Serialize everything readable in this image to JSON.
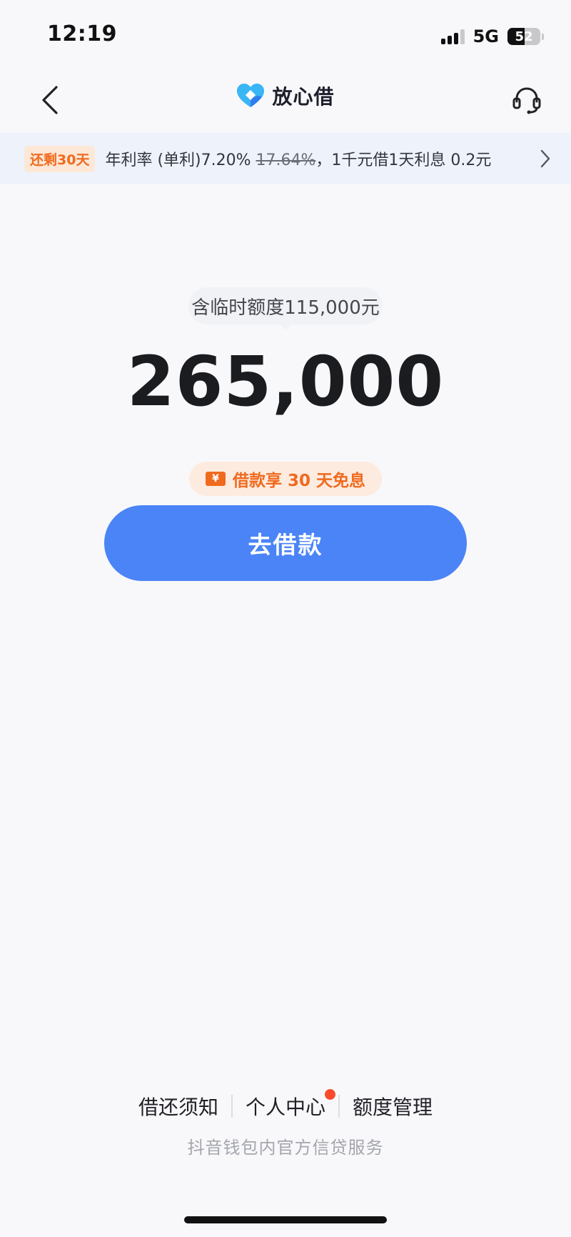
{
  "status_bar": {
    "time": "12:19",
    "network": "5G",
    "battery": "52",
    "battery_level": 0.52
  },
  "header": {
    "back_icon": "chevron-left-icon",
    "brand_name": "放心借",
    "brand_logo_icon": "heart-diamond-logo-icon",
    "support_icon": "headset-icon"
  },
  "promo": {
    "badge": "还剩30天",
    "text_prefix": "年利率 (单利)7.20% ",
    "struck_rate": "17.64%",
    "text_suffix": "，1千元借1天利息 0.2元",
    "chevron_icon": "chevron-right-icon"
  },
  "credit": {
    "temp_limit_tip": "含临时额度115,000元",
    "amount": "265,000"
  },
  "interest_free": {
    "icon": "yuan-coupon-icon",
    "coupon_symbol": "¥",
    "text": "借款享 30 天免息"
  },
  "borrow_button": {
    "label": "去借款"
  },
  "footer": {
    "links": [
      "借还须知",
      "个人中心",
      "额度管理"
    ],
    "service_note": "抖音钱包内官方信贷服务"
  },
  "colors": {
    "accent": "#4a84f7",
    "promo_orange": "#f06a1e",
    "notification_red": "#fb4b2d",
    "background": "#f8f8fa"
  }
}
